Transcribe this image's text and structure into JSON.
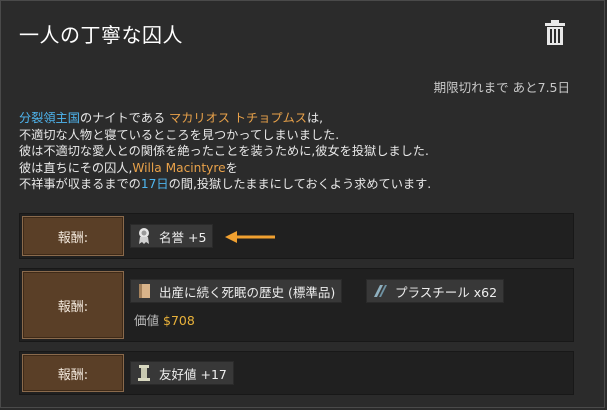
{
  "window": {
    "title": "一人の丁寧な囚人",
    "deadline": "期限切れまで あと7.5日"
  },
  "description": {
    "line1": {
      "faction": "分裂領主国",
      "mid": "のナイトである ",
      "person": "マカリオス トチョプムス",
      "end": "は,"
    },
    "line2": "不適切な人物と寝ているところを見つかってしまいました.",
    "line3": "彼は不適切な愛人との関係を絶ったことを装うために,彼女を投獄しました.",
    "line4": {
      "pre": "彼は直ちにその囚人,",
      "prisoner": "Willa Macintyre",
      "post": "を"
    },
    "line5": {
      "pre": "不祥事が収まるまでの",
      "days": "17日",
      "post": "の間,投獄したままにしておくよう求めています."
    }
  },
  "rewards": [
    {
      "button_label": "報酬:",
      "items": [
        {
          "icon": "honor-icon",
          "label": "名誉 +5"
        }
      ]
    },
    {
      "button_label": "報酬:",
      "items": [
        {
          "icon": "book-icon",
          "label": "出産に続く死眠の歴史 (標準品)"
        },
        {
          "icon": "plasteel-icon",
          "label": "プラスチール x62"
        }
      ],
      "value_label": "価値",
      "value": "$708"
    },
    {
      "button_label": "報酬:",
      "items": [
        {
          "icon": "goodwill-icon",
          "label": "友好値 +17"
        }
      ]
    }
  ],
  "colors": {
    "background": "#2b2b2b",
    "faction_blue": "#4fb6f0",
    "person_orange": "#e9a24a",
    "money_gold": "#e8b13a",
    "button_brown": "#5a3f27",
    "arrow_orange": "#f0a030"
  }
}
